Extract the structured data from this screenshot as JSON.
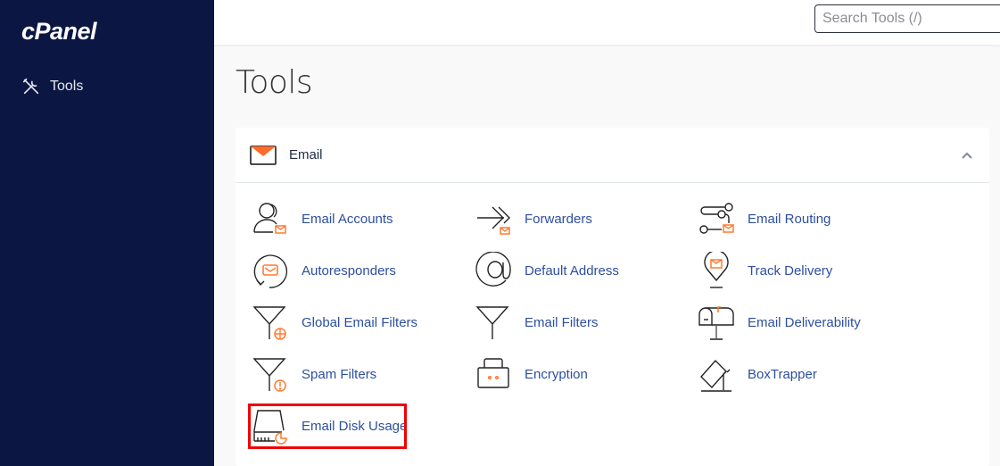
{
  "sidebar": {
    "logo": "cPanel",
    "items": [
      {
        "label": "Tools",
        "icon": "tools-icon"
      }
    ]
  },
  "topbar": {
    "search_placeholder": "Search Tools (/)",
    "search_value": ""
  },
  "page": {
    "title": "Tools"
  },
  "email_section": {
    "title": "Email",
    "icon": "envelope-icon",
    "expanded": true,
    "accent_color": "#ff6c2c",
    "tools": [
      {
        "label": "Email Accounts",
        "icon": "email-accounts-icon"
      },
      {
        "label": "Forwarders",
        "icon": "forwarders-icon"
      },
      {
        "label": "Email Routing",
        "icon": "email-routing-icon"
      },
      {
        "label": "Autoresponders",
        "icon": "autoresponders-icon"
      },
      {
        "label": "Default Address",
        "icon": "at-sign-icon"
      },
      {
        "label": "Track Delivery",
        "icon": "track-delivery-icon"
      },
      {
        "label": "Global Email Filters",
        "icon": "global-filter-icon"
      },
      {
        "label": "Email Filters",
        "icon": "filter-icon"
      },
      {
        "label": "Email Deliverability",
        "icon": "mailbox-icon"
      },
      {
        "label": "Spam Filters",
        "icon": "spam-filter-icon"
      },
      {
        "label": "Encryption",
        "icon": "encryption-icon"
      },
      {
        "label": "BoxTrapper",
        "icon": "boxtrapper-icon"
      },
      {
        "label": "Email Disk Usage",
        "icon": "disk-usage-icon",
        "highlighted": true
      }
    ]
  }
}
